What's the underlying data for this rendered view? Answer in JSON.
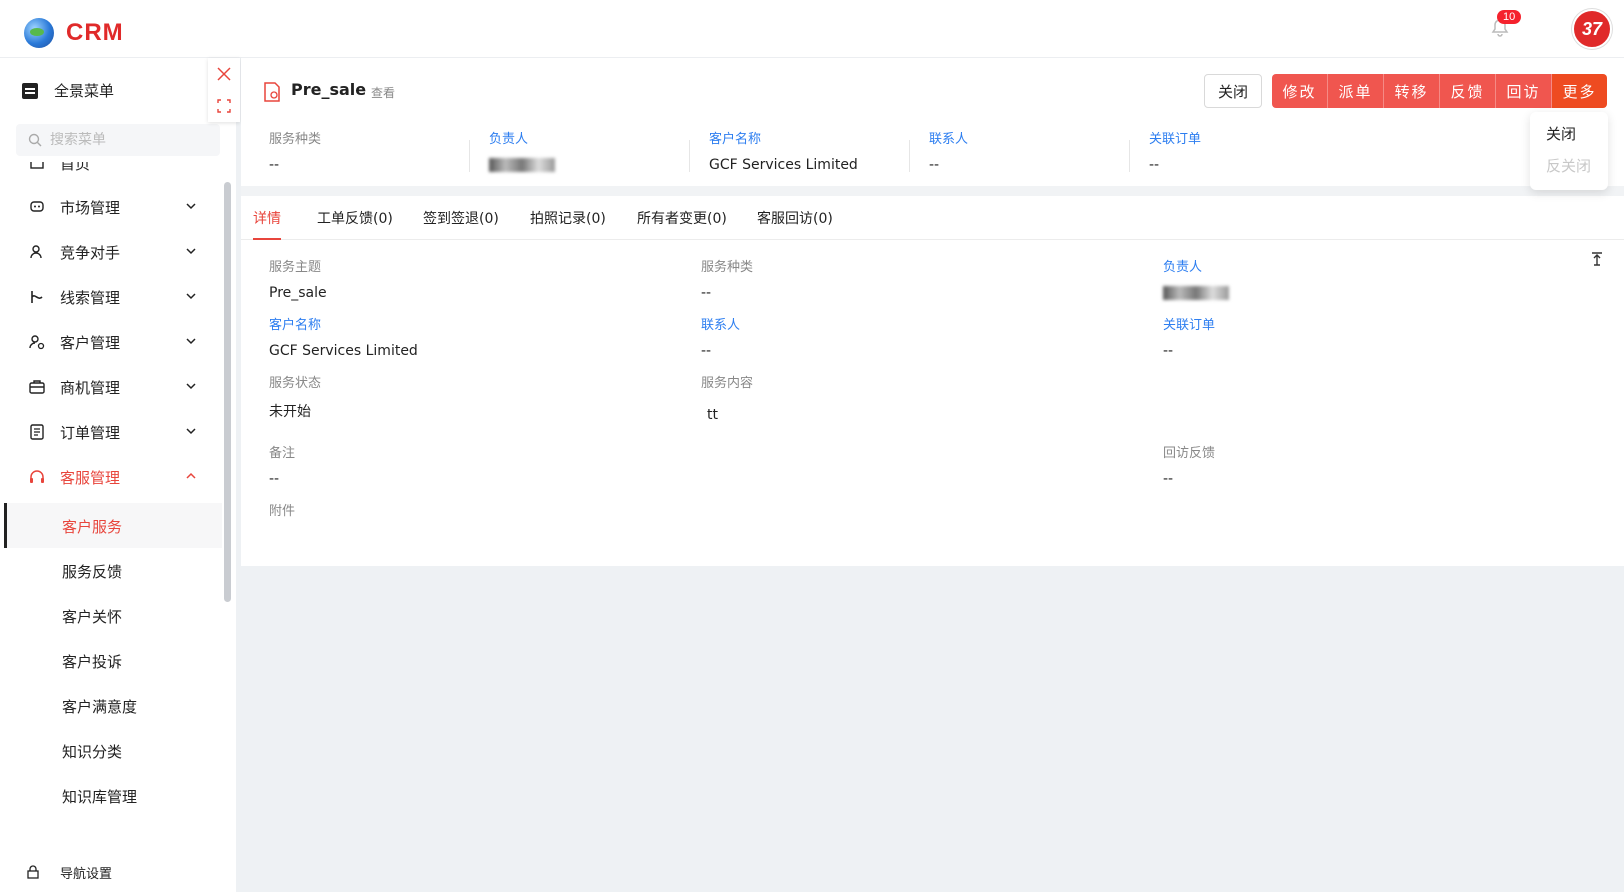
{
  "app": {
    "name": "CRM",
    "notification_count": "10",
    "avatar_text": "37"
  },
  "sidebar": {
    "all_menu_label": "全景菜单",
    "search_placeholder": "搜索菜单",
    "partial_item_label": "首页",
    "items": [
      {
        "label": "市场管理",
        "icon": "megaphone-icon"
      },
      {
        "label": "竞争对手",
        "icon": "users-icon"
      },
      {
        "label": "线索管理",
        "icon": "lead-icon"
      },
      {
        "label": "客户管理",
        "icon": "customer-icon"
      },
      {
        "label": "商机管理",
        "icon": "briefcase-icon"
      },
      {
        "label": "订单管理",
        "icon": "document-icon"
      },
      {
        "label": "客服管理",
        "icon": "headset-icon",
        "expanded": true
      }
    ],
    "sub_items": [
      {
        "label": "客户服务",
        "active": true
      },
      {
        "label": "服务反馈"
      },
      {
        "label": "客户关怀"
      },
      {
        "label": "客户投诉"
      },
      {
        "label": "客户满意度"
      },
      {
        "label": "知识分类"
      },
      {
        "label": "知识库管理"
      }
    ],
    "nav_settings_label": "导航设置"
  },
  "detail": {
    "title": "Pre_sale",
    "view_label": "查看",
    "close_button": "关闭",
    "actions": [
      "修改",
      "派单",
      "转移",
      "反馈",
      "回访",
      "更多"
    ],
    "summary": [
      {
        "key": "服务种类",
        "value": "--"
      },
      {
        "key": "负责人",
        "value": ""
      },
      {
        "key": "客户名称",
        "value": "GCF Services Limited"
      },
      {
        "key": "联系人",
        "value": "--"
      },
      {
        "key": "关联订单",
        "value": "--"
      }
    ],
    "tabs": [
      "详情",
      "工单反馈(0)",
      "签到签退(0)",
      "拍照记录(0)",
      "所有者变更(0)",
      "客服回访(0)"
    ],
    "fields": {
      "subject": {
        "key": "服务主题",
        "value": "Pre_sale"
      },
      "type": {
        "key": "服务种类",
        "value": "--"
      },
      "owner": {
        "key": "负责人",
        "value": ""
      },
      "customer": {
        "key": "客户名称",
        "value": "GCF Services Limited"
      },
      "contact": {
        "key": "联系人",
        "value": "--"
      },
      "order": {
        "key": "关联订单",
        "value": "--"
      },
      "status": {
        "key": "服务状态",
        "value": "未开始"
      },
      "content": {
        "key": "服务内容",
        "value": "tt"
      },
      "remark": {
        "key": "备注",
        "value": "--"
      },
      "feedback": {
        "key": "回访反馈",
        "value": "--"
      },
      "attachment": {
        "key": "附件"
      }
    }
  },
  "more_dropdown": {
    "items": [
      "关闭",
      "反关闭"
    ]
  },
  "colors": {
    "accent": "#e8453c",
    "link": "#2d7ef0",
    "action_button": "#f0564f"
  }
}
